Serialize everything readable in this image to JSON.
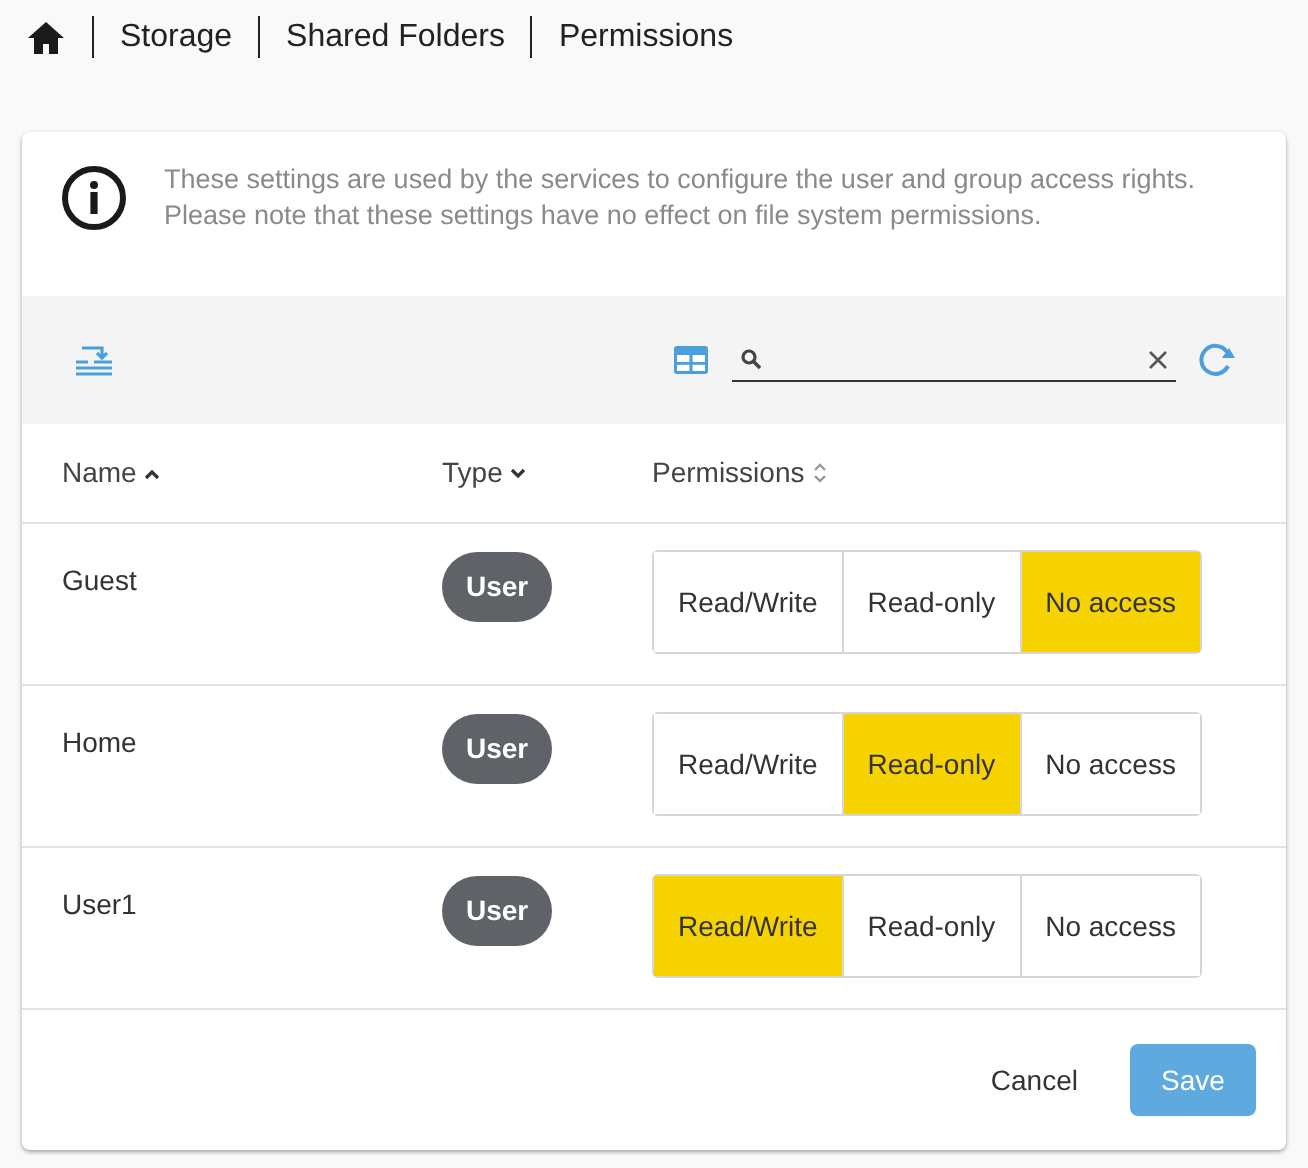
{
  "breadcrumb": [
    "Storage",
    "Shared Folders",
    "Permissions"
  ],
  "info": "These settings are used by the services to configure the user and group access rights. Please note that these settings have no effect on file system permissions.",
  "columns": [
    {
      "label": "Name",
      "kind": "ascending"
    },
    {
      "label": "Type",
      "kind": "descending"
    },
    {
      "label": "Permissions",
      "kind": "unsorted"
    }
  ],
  "rows": [
    {
      "name": "Guest",
      "type": "User",
      "options": [
        {
          "label": "Read/Write",
          "selected": false
        },
        {
          "label": "Read-only",
          "selected": false
        },
        {
          "label": "No access",
          "selected": true
        }
      ]
    },
    {
      "name": "Home",
      "type": "User",
      "options": [
        {
          "label": "Read/Write",
          "selected": false
        },
        {
          "label": "Read-only",
          "selected": true
        },
        {
          "label": "No access",
          "selected": false
        }
      ]
    },
    {
      "name": "User1",
      "type": "User",
      "options": [
        {
          "label": "Read/Write",
          "selected": true
        },
        {
          "label": "Read-only",
          "selected": false
        },
        {
          "label": "No access",
          "selected": false
        }
      ]
    }
  ],
  "buttons": {
    "cancel": "Cancel",
    "save": "Save"
  }
}
